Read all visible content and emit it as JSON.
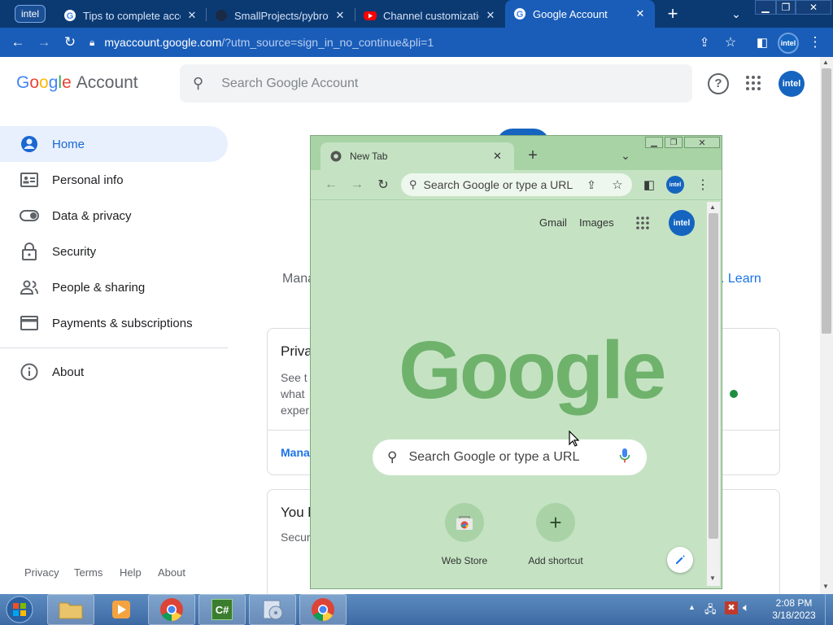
{
  "browser": {
    "profile_label": "intel",
    "tabs": [
      {
        "title": "Tips to complete account"
      },
      {
        "title": "SmallProjects/pybrowser"
      },
      {
        "title": "Channel customization"
      },
      {
        "title": "Google Account"
      }
    ],
    "new_tab_symbol": "+",
    "url_domain": "myaccount.google.com",
    "url_rest": "/?utm_source=sign_in_no_continue&pli=1",
    "avatar_label": "intel"
  },
  "account_page": {
    "logo_letters": [
      "G",
      "o",
      "o",
      "g",
      "l",
      "e"
    ],
    "logo_suffix": "Account",
    "search_placeholder": "Search Google Account",
    "avatar_label": "intel",
    "nav": [
      {
        "label": "Home",
        "icon": "account-circle-icon",
        "selected": true
      },
      {
        "label": "Personal info",
        "icon": "id-card-icon"
      },
      {
        "label": "Data & privacy",
        "icon": "toggle-icon"
      },
      {
        "label": "Security",
        "icon": "lock-icon"
      },
      {
        "label": "People & sharing",
        "icon": "people-icon"
      },
      {
        "label": "Payments & subscriptions",
        "icon": "credit-card-icon"
      }
    ],
    "about_label": "About",
    "footer": [
      "Privacy",
      "Terms",
      "Help",
      "About"
    ],
    "manage_partial": "Mana",
    "learn_partial": ". Learn",
    "card1": {
      "title": "Priva",
      "lines": [
        "See t",
        "what",
        "exper"
      ],
      "link": "Mana"
    },
    "card2": {
      "title": "You h",
      "line": "Secur"
    }
  },
  "popup": {
    "tab_title": "New Tab",
    "omnibox_placeholder": "Search Google or type a URL",
    "gmail_label": "Gmail",
    "images_label": "Images",
    "avatar_label": "intel",
    "logo_text": "Google",
    "search_placeholder": "Search Google or type a URL",
    "shortcuts": [
      {
        "label": "Web Store"
      },
      {
        "label": "Add shortcut",
        "symbol": "+"
      }
    ]
  },
  "taskbar": {
    "time": "2:08 PM",
    "date": "3/18/2023",
    "csharp_label": "C#"
  },
  "colors": {
    "chrome_tabstrip": "#0b3a73",
    "chrome_toolbar": "#1a5db8",
    "popup_bg": "#c5e3c3",
    "accent_blue": "#1967d2"
  }
}
